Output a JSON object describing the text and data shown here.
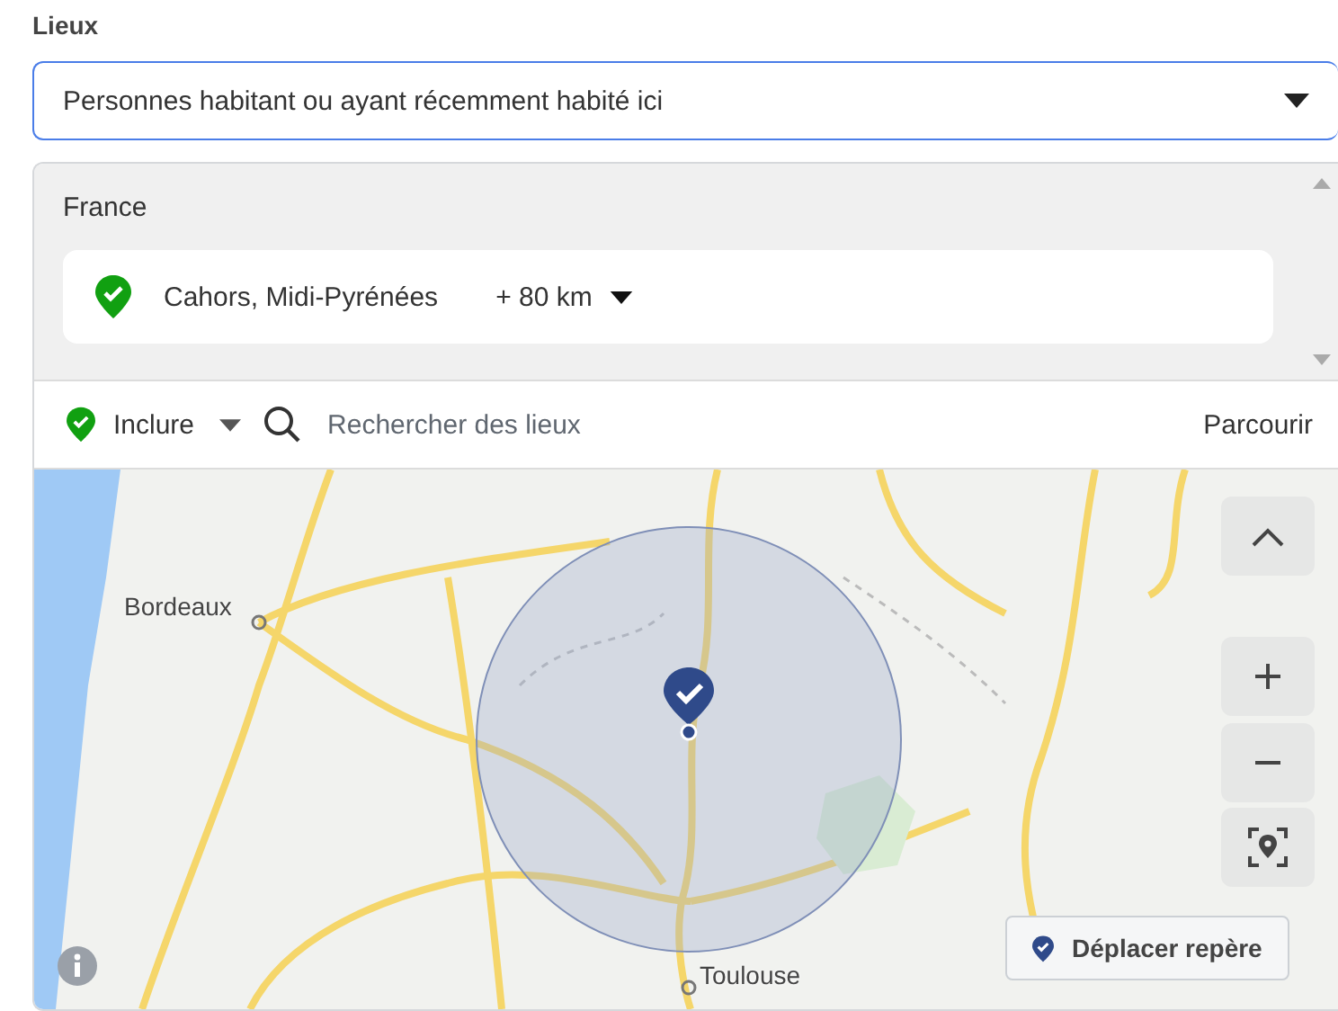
{
  "section_label": "Lieux",
  "audience_select": {
    "value": "Personnes habitant ou ayant récemment habité ici"
  },
  "locations_panel": {
    "country": "France",
    "locations": [
      {
        "name": "Cahors, Midi-Pyrénées",
        "radius": "+ 80 km",
        "included": true
      }
    ]
  },
  "toolbar": {
    "mode": "Inclure",
    "search": {
      "placeholder": "Rechercher des lieux"
    },
    "browse": "Parcourir"
  },
  "map": {
    "cities": [
      "Bordeaux",
      "Toulouse"
    ],
    "move_pin_button": "Déplacer repère"
  }
}
